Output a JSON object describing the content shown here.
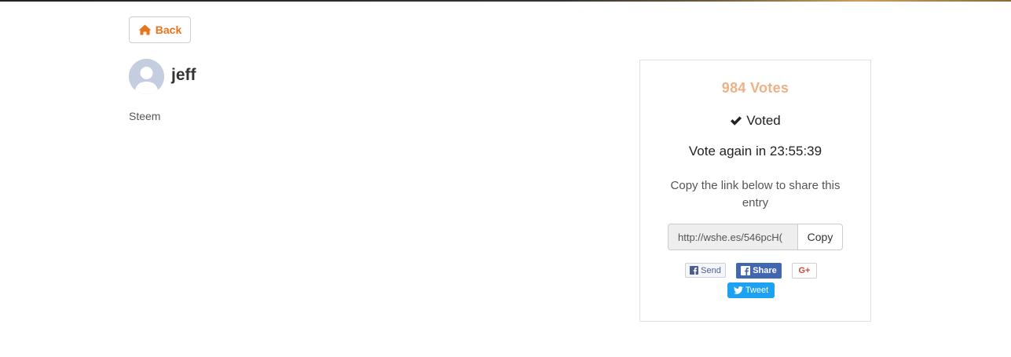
{
  "nav": {
    "back_label": "Back"
  },
  "profile": {
    "username": "jeff",
    "bio": "Steem"
  },
  "vote_panel": {
    "votes_label": "984 Votes",
    "voted_label": "Voted",
    "vote_again_label": "Vote again in 23:55:39",
    "share_instruction": "Copy the link below to share this entry",
    "share_link_value": "http://wshe.es/546pcH(",
    "copy_label": "Copy",
    "share_buttons": {
      "fb_send": "Send",
      "fb_share": "Share",
      "gplus": "G+",
      "tweet": "Tweet"
    }
  },
  "icons": {
    "back": "home-icon",
    "voted": "check-icon",
    "avatar": "default-user-icon",
    "fb": "facebook-icon",
    "twitter": "twitter-icon"
  },
  "colors": {
    "accent": "#e8741c",
    "votes_text": "#f0b086",
    "facebook": "#4267b2",
    "twitter": "#1da1f2",
    "gplus": "#d34836"
  }
}
